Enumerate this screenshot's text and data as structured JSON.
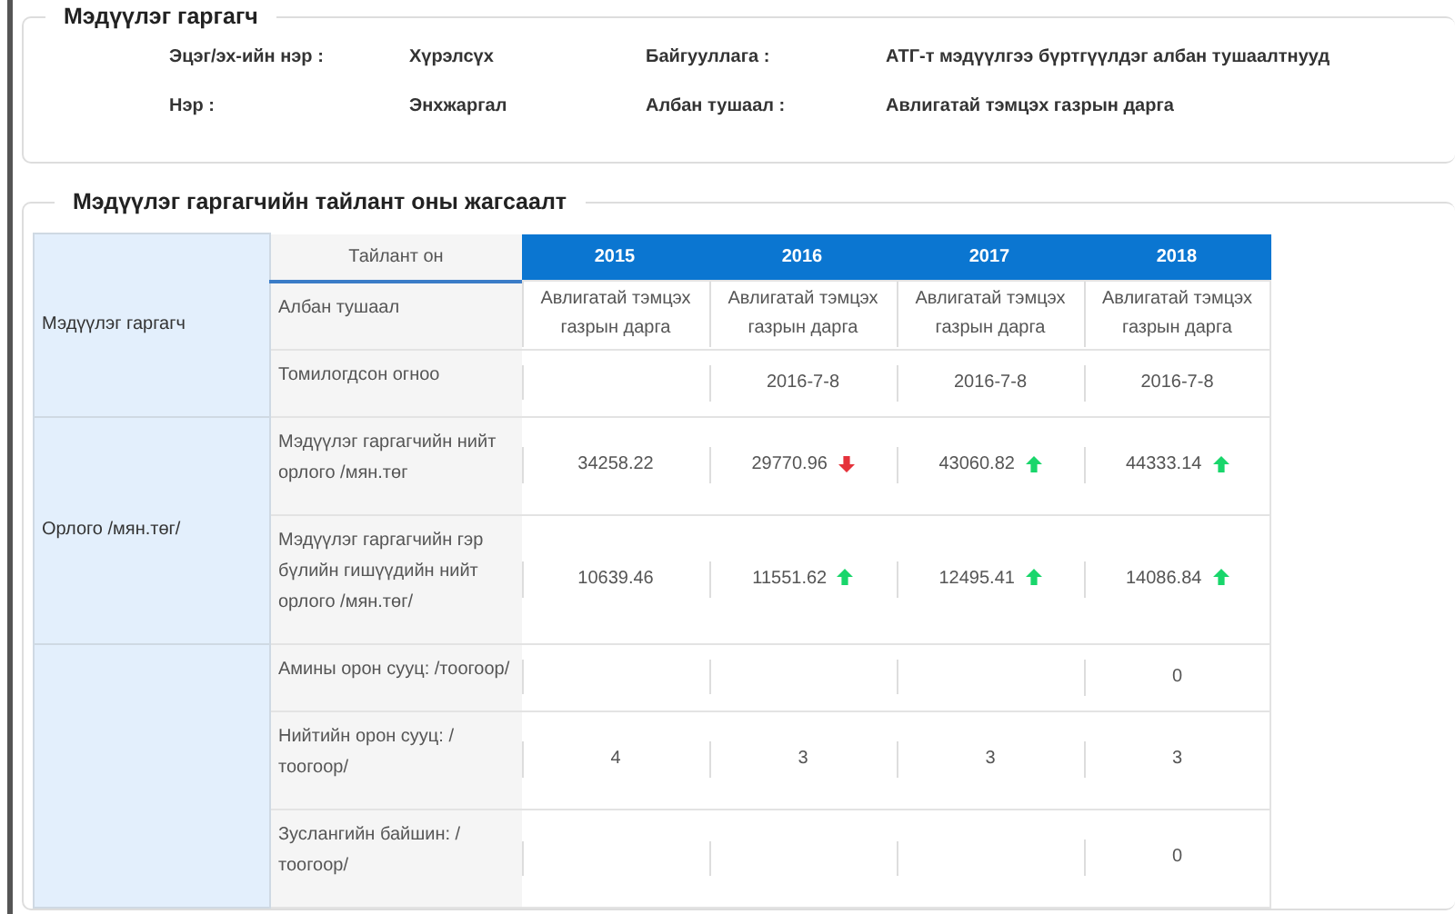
{
  "profile": {
    "title": "Мэдүүлэг гаргагч",
    "fields": [
      {
        "label": "Эцэг/эх-ийн нэр :",
        "value": "Хүрэлсүх"
      },
      {
        "label": "Байгууллага :",
        "value": "АТГ-т мэдүүлгээ бүртгүүлдэг албан тушаалтнууд"
      },
      {
        "label": "Нэр :",
        "value": "Энхжаргал"
      },
      {
        "label": "Албан тушаал :",
        "value": "Авлигатай тэмцэх газрын дарга"
      }
    ]
  },
  "report": {
    "title": "Мэдүүлэг гаргагчийн тайлант оны жагсаалт",
    "header_label": "Тайлант он",
    "years": [
      "2015",
      "2016",
      "2017",
      "2018"
    ],
    "groups": [
      {
        "label": "Мэдүүлэг гаргагч",
        "rows": [
          {
            "label": "Албан тушаал",
            "cells": [
              {
                "text": "Авлигатай тэмцэх газрын дарга"
              },
              {
                "text": "Авлигатай тэмцэх газрын дарга"
              },
              {
                "text": "Авлигатай тэмцэх газрын дарга"
              },
              {
                "text": "Авлигатай тэмцэх газрын дарга"
              }
            ]
          },
          {
            "label": "Томилогдсон огноо",
            "cells": [
              {},
              {
                "text": "2016-7-8"
              },
              {
                "text": "2016-7-8"
              },
              {
                "text": "2016-7-8"
              }
            ]
          }
        ]
      },
      {
        "label": "Орлого /мян.төг/",
        "rows": [
          {
            "label": "Мэдүүлэг гаргагчийн нийт орлого /мян.төг",
            "cells": [
              {
                "text": "34258.22"
              },
              {
                "text": "29770.96",
                "rising": false
              },
              {
                "text": "43060.82",
                "rising": true
              },
              {
                "text": "44333.14",
                "rising": true
              }
            ]
          },
          {
            "label": "Мэдүүлэг гаргагчийн гэр бүлийн гишүүдийн нийт орлого /мян.төг/",
            "cells": [
              {
                "text": "10639.46"
              },
              {
                "text": "11551.62",
                "rising": true
              },
              {
                "text": "12495.41",
                "rising": true
              },
              {
                "text": "14086.84",
                "rising": true
              }
            ]
          }
        ]
      },
      {
        "rows": [
          {
            "label": "Амины орон сууц: /тоогоор/",
            "cells": [
              {},
              {},
              {},
              {
                "text": "0"
              }
            ]
          },
          {
            "label": "Нийтийн орон сууц: /тоогоор/",
            "cells": [
              {
                "text": "4"
              },
              {
                "text": "3"
              },
              {
                "text": "3"
              },
              {
                "text": "3"
              }
            ]
          },
          {
            "label": "Зуслангийн байшин: /тоогоор/",
            "cells": [
              {},
              {},
              {},
              {
                "text": "0"
              }
            ]
          }
        ]
      }
    ]
  }
}
